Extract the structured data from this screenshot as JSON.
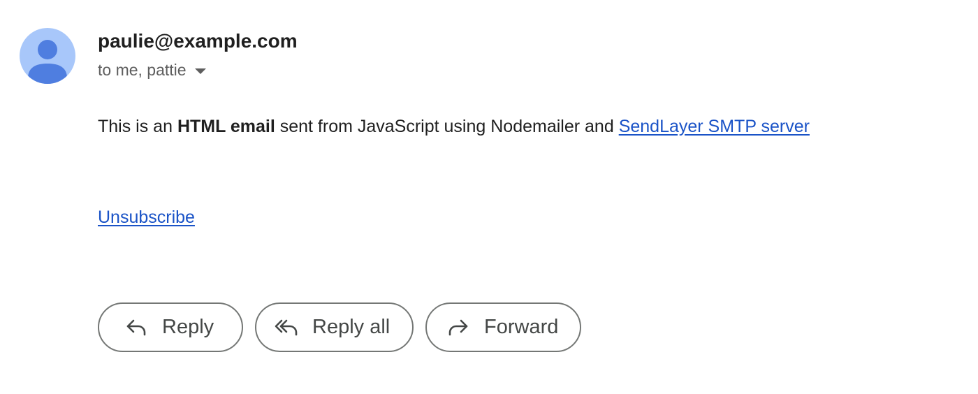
{
  "message": {
    "sender": "paulie@example.com",
    "recipients": "to me, pattie",
    "body": {
      "text_before": "This is an ",
      "bold_text": "HTML email",
      "text_middle": " sent from JavaScript using Nodemailer and ",
      "link_text": "SendLayer SMTP server"
    },
    "unsubscribe_label": "Unsubscribe"
  },
  "actions": {
    "reply_label": "Reply",
    "reply_all_label": "Reply all",
    "forward_label": "Forward"
  },
  "icons": {
    "avatar": "person-avatar-icon",
    "recipients_toggle": "caret-down-icon",
    "reply": "reply-arrow-icon",
    "reply_all": "reply-all-arrow-icon",
    "forward": "forward-arrow-icon"
  },
  "colors": {
    "avatar_background": "#a8c7fa",
    "avatar_figure": "#4f7ee0",
    "link": "#1a53c7",
    "button_border": "#747775",
    "button_text": "#444746"
  }
}
